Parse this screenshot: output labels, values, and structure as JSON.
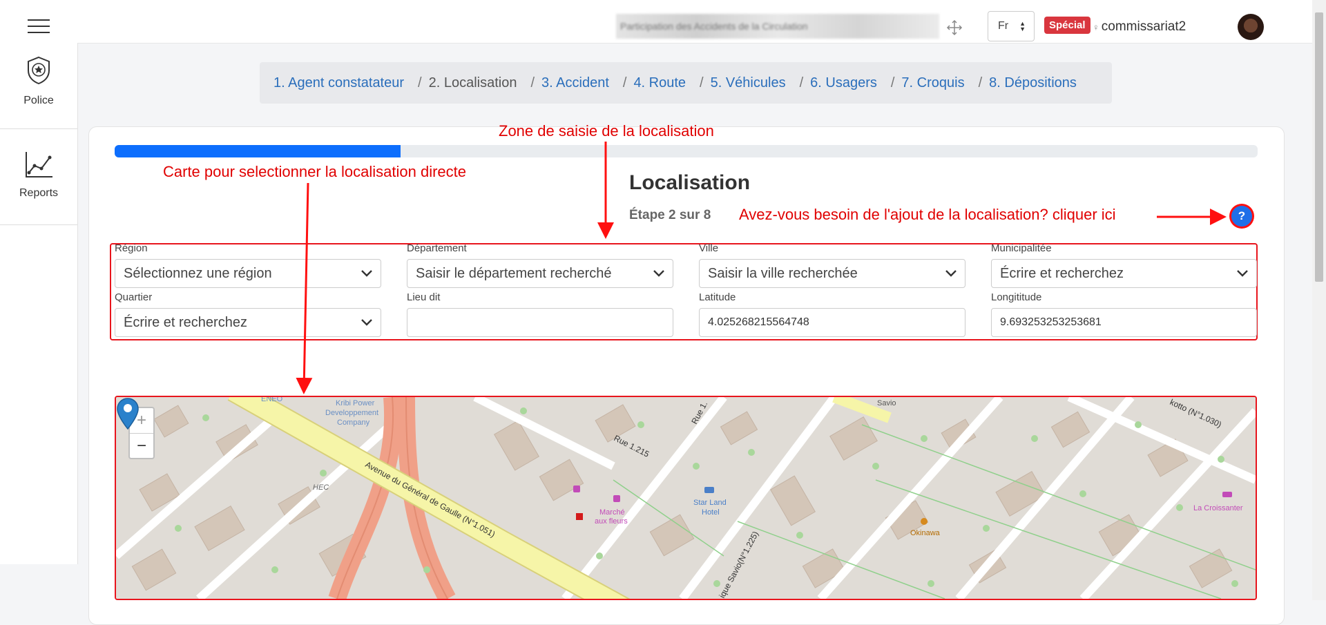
{
  "header": {
    "blurred_title": "Participation des Accidents de la Circulation",
    "language": "Fr",
    "badge": "Spécial",
    "username": "commissariat2"
  },
  "sidebar": {
    "items": [
      {
        "label": "Police",
        "icon": "police-badge-icon"
      },
      {
        "label": "Reports",
        "icon": "line-chart-icon"
      }
    ]
  },
  "breadcrumb": [
    {
      "label": "1. Agent constatateur",
      "active": false
    },
    {
      "label": "2. Localisation",
      "active": true
    },
    {
      "label": "3. Accident",
      "active": false
    },
    {
      "label": "4. Route",
      "active": false
    },
    {
      "label": "5. Véhicules",
      "active": false
    },
    {
      "label": "6. Usagers",
      "active": false
    },
    {
      "label": "7. Croquis",
      "active": false
    },
    {
      "label": "8. Dépositions",
      "active": false
    }
  ],
  "progress": {
    "fraction": 0.25
  },
  "main": {
    "title": "Localisation",
    "step": "Étape 2 sur 8",
    "help_symbol": "?"
  },
  "annotations": {
    "zone": "Zone de saisie de la localisation",
    "map": "Carte pour selectionner la localisation directe",
    "help": "Avez-vous besoin de l'ajout de la localisation? cliquer ici"
  },
  "form": {
    "region": {
      "label": "Région",
      "value": "Sélectionnez une région"
    },
    "departement": {
      "label": "Département",
      "value": "Saisir le département recherché"
    },
    "ville": {
      "label": "Ville",
      "value": "Saisir la ville recherchée"
    },
    "municipalite": {
      "label": "Municipalitée",
      "value": "Écrire et recherchez"
    },
    "quartier": {
      "label": "Quartier",
      "value": "Écrire et recherchez"
    },
    "lieu_dit": {
      "label": "Lieu dit",
      "value": ""
    },
    "latitude": {
      "label": "Latitude",
      "value": "4.025268215564748"
    },
    "longitude": {
      "label": "Longititude",
      "value": "9.693253253253681"
    }
  },
  "map": {
    "zoom_in": "+",
    "zoom_out": "−",
    "labels": {
      "eneo": "ENEO",
      "kribi1": "Kribi Power",
      "kribi2": "Developpement",
      "kribi3": "Company",
      "hec": "HEC",
      "avenue": "Avenue du Général de Gaulle (N°1.051)",
      "rue": "Rue 1.215",
      "rue2": "Rue 1.",
      "marche1": "Marché",
      "marche2": "aux fleurs",
      "starland1": "Star Land",
      "starland2": "Hotel",
      "savio_street": "ique Savio(N°1.225)",
      "savio": "Savio",
      "okinawa": "Okinawa",
      "kotto": "kotto (N°1.030)",
      "croissanter": "La Croissanter"
    }
  }
}
